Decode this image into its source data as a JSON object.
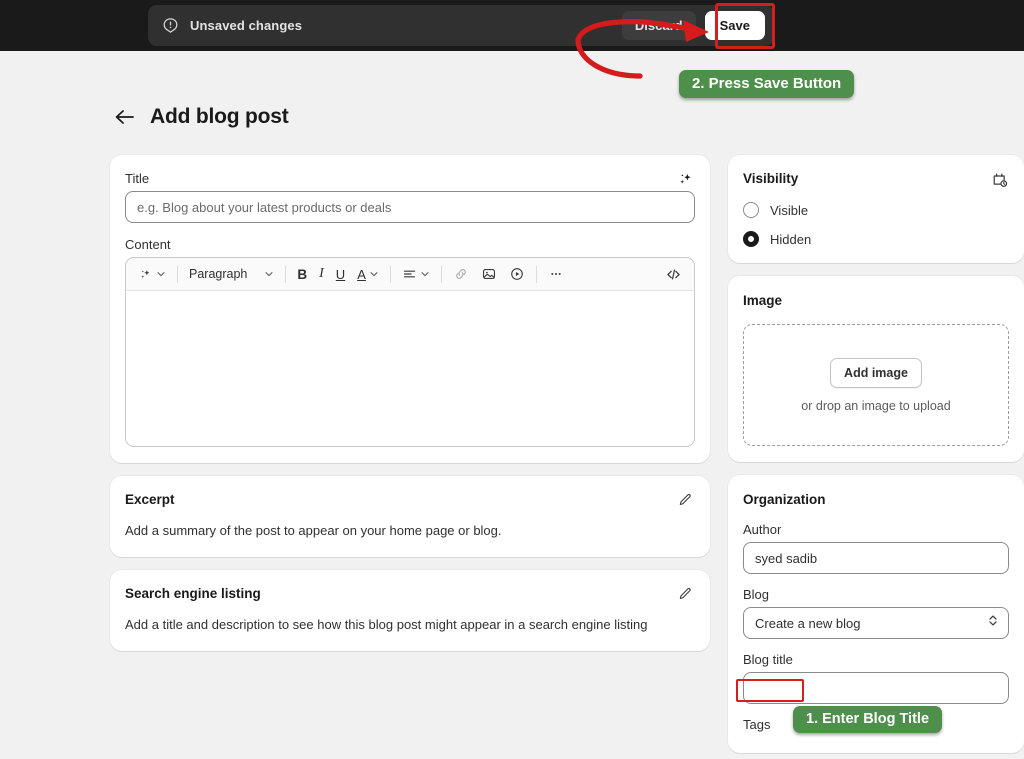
{
  "topbar": {
    "status_icon": "alert-circle-icon",
    "status_text": "Unsaved changes",
    "discard_label": "Discard",
    "save_label": "Save"
  },
  "header": {
    "back_icon": "arrow-left-icon",
    "title": "Add blog post"
  },
  "title_card": {
    "label": "Title",
    "placeholder": "e.g. Blog about your latest products or deals",
    "value": "",
    "magic_icon": "sparkle-icon"
  },
  "content_card": {
    "label": "Content",
    "toolbar": {
      "magic_label": "sparkle-icon",
      "block_format": "Paragraph",
      "bold": "B",
      "italic": "I",
      "underline": "U",
      "text_color": "A",
      "align": "align-left-icon",
      "link": "link-icon",
      "image": "image-icon",
      "video": "video-icon",
      "more": "ellipsis-icon",
      "code": "code-icon"
    },
    "body_value": ""
  },
  "excerpt_card": {
    "title": "Excerpt",
    "edit_icon": "pencil-icon",
    "description": "Add a summary of the post to appear on your home page or blog."
  },
  "seo_card": {
    "title": "Search engine listing",
    "edit_icon": "pencil-icon",
    "description": "Add a title and description to see how this blog post might appear in a search engine listing"
  },
  "visibility_card": {
    "title": "Visibility",
    "schedule_icon": "calendar-clock-icon",
    "options": [
      {
        "label": "Visible",
        "selected": false
      },
      {
        "label": "Hidden",
        "selected": true
      }
    ]
  },
  "image_card": {
    "title": "Image",
    "add_button": "Add image",
    "drop_hint": "or drop an image to upload"
  },
  "organization_card": {
    "title": "Organization",
    "author_label": "Author",
    "author_value": "syed sadib",
    "blog_label": "Blog",
    "blog_value": "Create a new blog",
    "blog_chevron_icon": "chevron-up-down-icon",
    "blog_title_label": "Blog title",
    "blog_title_value": "",
    "tags_label": "Tags"
  },
  "annotations": {
    "colors": {
      "callout_green": "#4f8f4c",
      "highlight_red": "#d31f1f"
    },
    "step_blog_title": "1. Enter Blog Title",
    "step_save": "2. Press Save Button"
  }
}
